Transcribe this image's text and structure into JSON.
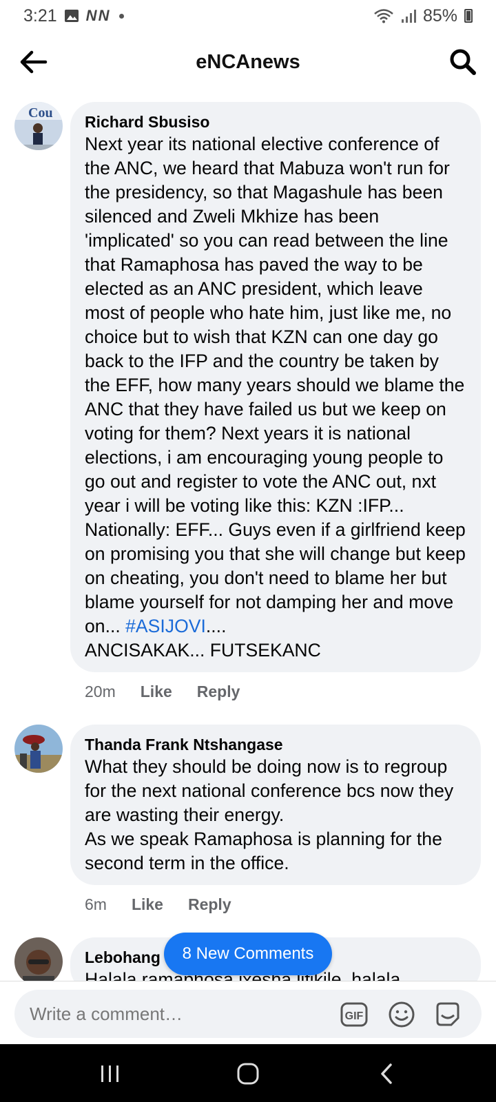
{
  "status": {
    "time": "3:21",
    "notif": "N N",
    "battery": "85%"
  },
  "header": {
    "title": "eNCAnews"
  },
  "comments": [
    {
      "author": "Richard Sbusiso",
      "text": "Next year its national elective conference of the ANC, we heard that Mabuza won't run for the presidency, so that Magashule has been silenced and Zweli Mkhize has been 'implicated' so you can read between the line that Ramaphosa has paved the way to be elected as an ANC president, which leave most of people who hate him, just like me, no choice but to wish that KZN can one day go back to the IFP and the country be taken by the EFF, how many years should we blame the ANC that they have failed us but we keep on voting for them? Next years it is national elections, i am encouraging young people to go out and register to vote the ANC out, nxt year i will be voting like this: KZN :IFP... Nationally: EFF... Guys even if a girlfriend keep on promising you that she will change but keep on cheating, you don't need to blame her but blame yourself for not damping her and move on... ",
      "hashtag": "#ASIJOVI",
      "text_end": "....\nANCISAKAK... FUTSEKANC",
      "time": "20m",
      "like": "Like",
      "reply": "Reply"
    },
    {
      "author": "Thanda Frank Ntshangase",
      "text": "What they should be doing now is to regroup for the next national conference bcs now they are wasting their energy.\nAs we speak Ramaphosa is planning for the second term in the office.",
      "time": "6m",
      "like": "Like",
      "reply": "Reply"
    },
    {
      "author": "Lebohang",
      "text": "Halala ramaphosa ixesha lifikile, halala"
    }
  ],
  "new_comments_button": "8 New Comments",
  "composer": {
    "placeholder": "Write a comment…"
  },
  "colors": {
    "accent": "#1877f2",
    "bubble": "#f0f2f5",
    "hashtag": "#1b6bd8"
  }
}
